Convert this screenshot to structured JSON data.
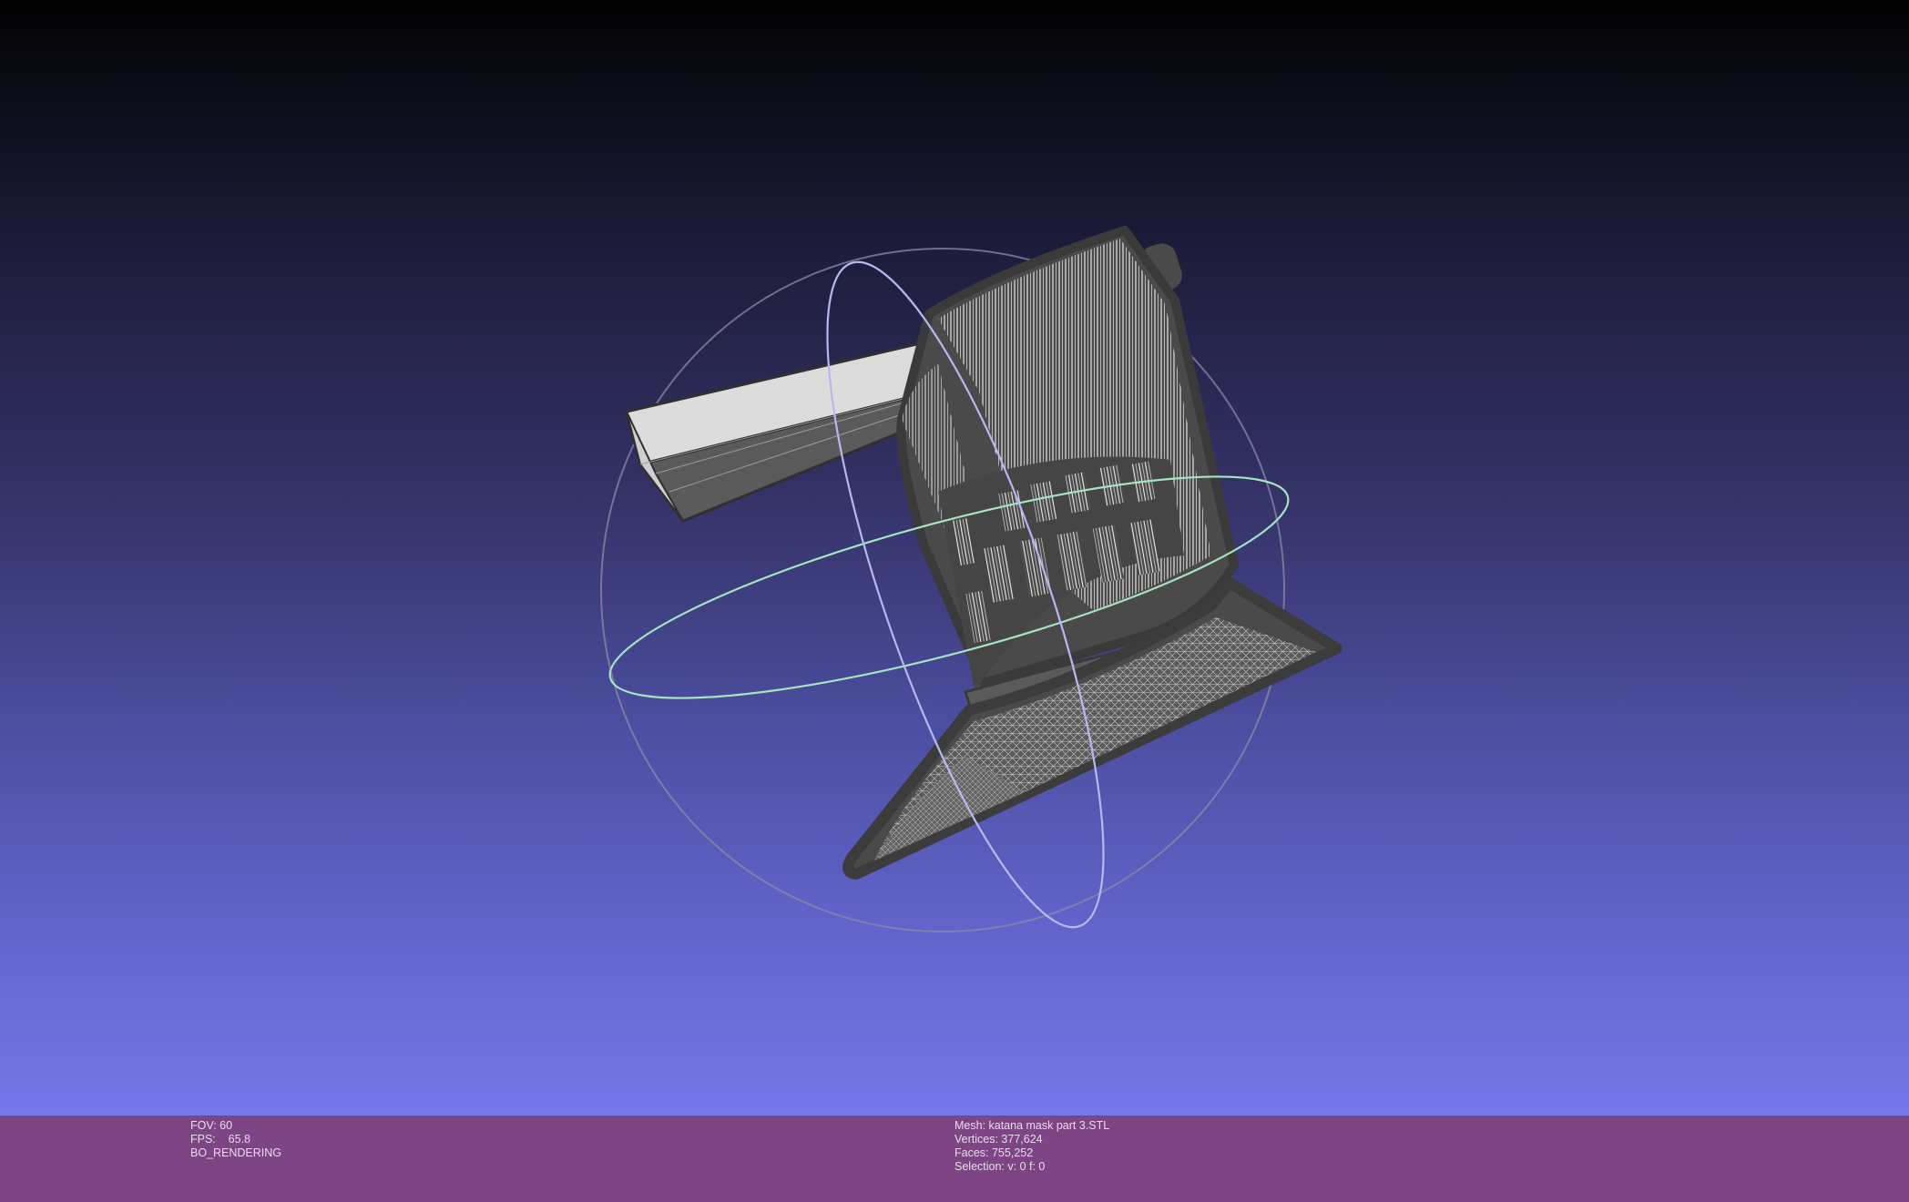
{
  "viewport": {
    "background_top": "#020203",
    "background_bottom": "#7677e9",
    "mesh_color": "#4a4a4a",
    "wire_color": "#e8e8e8",
    "trackball": {
      "rings": [
        "horizontal-ring",
        "vertical-ring",
        "outer-ring"
      ],
      "colors": {
        "horizontal": "#a6e3c0",
        "vertical": "#b8b8f0",
        "outer": "#8a8aa8"
      }
    }
  },
  "status_bar": {
    "background": "#7e4584",
    "left": {
      "fov": "FOV: 60",
      "fps": "FPS:    65.8",
      "mode": "BO_RENDERING"
    },
    "right": {
      "mesh": "Mesh: katana mask part 3.STL",
      "vertices": "Vertices: 377,624",
      "faces": "Faces: 755,252",
      "selection": "Selection: v: 0 f: 0"
    }
  }
}
